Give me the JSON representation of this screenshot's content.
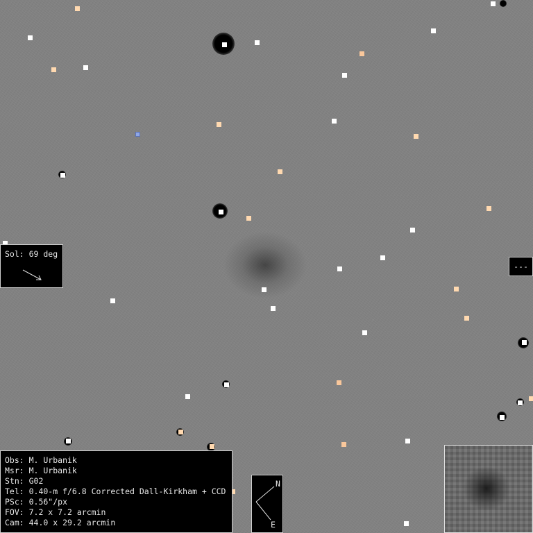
{
  "info": {
    "observer": "Obs: M. Urbanik",
    "measurer": "Msr: M. Urbanik",
    "station": "Stn: G02",
    "telescope": "Tel: 0.40-m f/6.8 Corrected Dall-Kirkham + CCD",
    "pixel_scale": "PSc: 0.56\"/px",
    "field_of_view": "FOV: 7.2 x 7.2 arcmin",
    "camera": "Cam: 44.0 x 29.2 arcmin"
  },
  "sol": {
    "label": "Sol: 69 deg"
  },
  "rate": {
    "label": "---"
  },
  "compass": {
    "north": "N",
    "east": "E"
  },
  "colors": {
    "background": "#828282",
    "marker_white": "#ffffff",
    "marker_peach": "#ffd9b0",
    "marker_blue": "#8fa7e6",
    "panel": "#000000",
    "panel_text": "#e8e8e8"
  }
}
